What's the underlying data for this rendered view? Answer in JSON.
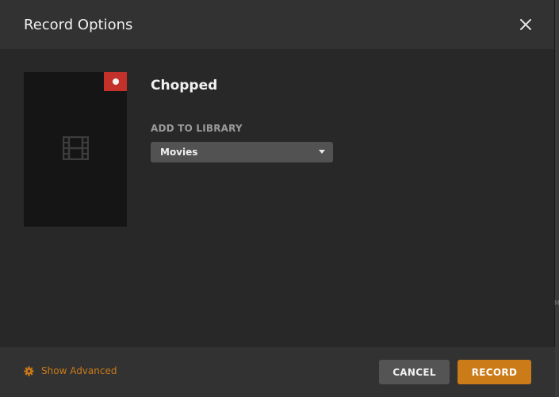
{
  "dialog": {
    "title": "Record Options",
    "close_icon": "close-icon"
  },
  "item": {
    "title": "Chopped",
    "poster_icon": "film-icon",
    "badge_icon": "record-dot-icon"
  },
  "library": {
    "label": "ADD TO LIBRARY",
    "selected": "Movies"
  },
  "footer": {
    "advanced_label": "Show Advanced",
    "advanced_icon": "gear-icon",
    "cancel_label": "CANCEL",
    "record_label": "RECORD"
  },
  "edge_text": "M",
  "colors": {
    "accent": "#cc7b19",
    "record_badge": "#c3312a",
    "background": "#282828"
  }
}
